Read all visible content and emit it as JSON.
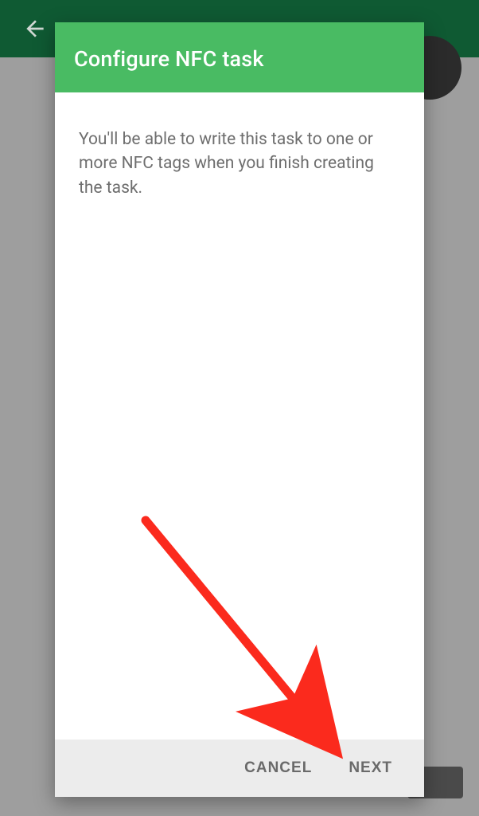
{
  "colors": {
    "accent": "#49bb63",
    "appbar_bg_dim": "#0f5a33",
    "text_muted": "#6e6e6e",
    "action_text": "#6a6a6a",
    "annotation": "#fb2a1d"
  },
  "background": {
    "back_icon": "arrow-back"
  },
  "dialog": {
    "title": "Configure NFC task",
    "body": "You'll be able to write this task to one or more NFC tags when you finish creating the task.",
    "actions": {
      "cancel": "CANCEL",
      "next": "NEXT"
    }
  }
}
